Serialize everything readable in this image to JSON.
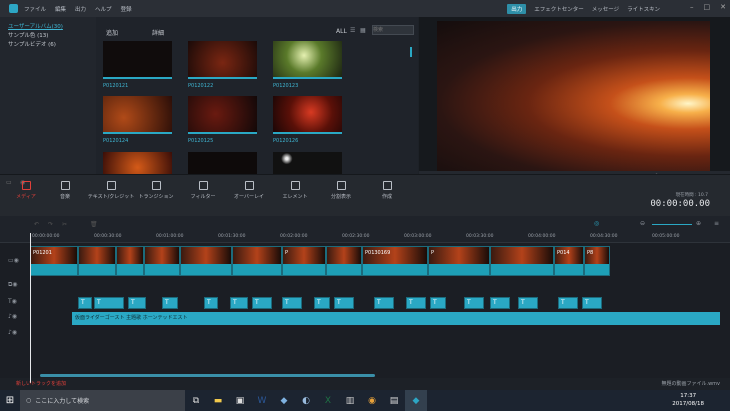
{
  "menu": [
    "ファイル",
    "編集",
    "出力",
    "ヘルプ",
    "登録"
  ],
  "header": {
    "export": "出力",
    "effect_center": "エフェクトセンター",
    "message": "メッセージ",
    "license": "ライトスキン"
  },
  "library": {
    "items": [
      "ユーザーアルバム(30)",
      "サンプル色 (13)",
      "サンプルビデオ (6)"
    ]
  },
  "media": {
    "add": "追加",
    "filter": "詳細",
    "all": "ALL",
    "search_placeholder": "検索",
    "thumbs": [
      "P0120121",
      "P0120122",
      "P0120123",
      "P0120124",
      "P0120125",
      "P0120126",
      "",
      "",
      ""
    ]
  },
  "toolbar": [
    "メディア",
    "音楽",
    "テキスト/クレジット",
    "トランジション",
    "フィルター",
    "オーバーレイ",
    "エレメント",
    "分割表示",
    "作成"
  ],
  "timecode": "00:00:00.00",
  "project_length": "現在時間 : 10.7",
  "ruler": [
    "00:00:00:00",
    "00:00:30:00",
    "00:01:00:00",
    "00:01:30:00",
    "00:02:00:00",
    "00:02:30:00",
    "00:03:00:00",
    "00:03:30:00",
    "00:04:00:00",
    "00:04:30:00",
    "00:05:00:00"
  ],
  "video_labels": [
    "P01201",
    "",
    "",
    "",
    "",
    "P",
    "",
    "P0130169",
    "P",
    "",
    "P014",
    "P8"
  ],
  "audio_label": "仮面ライダーゴースト 主題歌 ホーンテッドエスト",
  "add_track": "新しいトラックを追加",
  "project_file": "無題の動画ファイル.wmv",
  "taskbar": {
    "search": "ここに入力して検索",
    "time": "17:37",
    "date": "2017/08/18"
  }
}
